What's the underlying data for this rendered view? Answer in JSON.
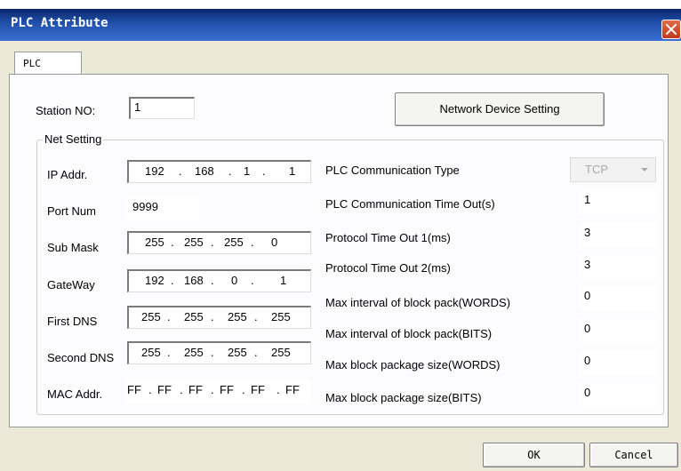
{
  "window": {
    "title": "PLC Attribute"
  },
  "tabs": [
    {
      "label": "PLC"
    }
  ],
  "station": {
    "label": "Station NO:",
    "value": "1"
  },
  "network_button": "Network Device Setting",
  "net_setting": {
    "group_label": "Net Setting",
    "ip": {
      "label": "IP Addr.",
      "octets": [
        "192",
        "168",
        "1",
        "1"
      ]
    },
    "port": {
      "label": "Port Num",
      "value": "9999"
    },
    "mask": {
      "label": "Sub Mask",
      "octets": [
        "255",
        "255",
        "255",
        "0"
      ]
    },
    "gateway": {
      "label": "GateWay",
      "octets": [
        "192",
        "168",
        "0",
        "1"
      ]
    },
    "dns1": {
      "label": "First DNS",
      "octets": [
        "255",
        "255",
        "255",
        "255"
      ]
    },
    "dns2": {
      "label": "Second DNS",
      "octets": [
        "255",
        "255",
        "255",
        "255"
      ]
    },
    "mac": {
      "label": "MAC Addr.",
      "parts": [
        "FF",
        "FF",
        "FF",
        "FF",
        "FF",
        "FF"
      ]
    }
  },
  "plc": {
    "comm_type": {
      "label": "PLC Communication Type",
      "value": "TCP"
    },
    "comm_timeout": {
      "label": "PLC Communication Time Out(s)",
      "value": "1"
    },
    "proto1": {
      "label": "Protocol Time Out 1(ms)",
      "value": "3"
    },
    "proto2": {
      "label": "Protocol Time Out 2(ms)",
      "value": "3"
    },
    "max_int_words": {
      "label": "Max interval of block pack(WORDS)",
      "value": "0"
    },
    "max_int_bits": {
      "label": "Max interval of block pack(BITS)",
      "value": "0"
    },
    "max_size_words": {
      "label": "Max block package size(WORDS)",
      "value": "0"
    },
    "max_size_bits": {
      "label": "Max block package size(BITS)",
      "value": "0"
    }
  },
  "buttons": {
    "ok": "OK",
    "cancel": "Cancel"
  }
}
